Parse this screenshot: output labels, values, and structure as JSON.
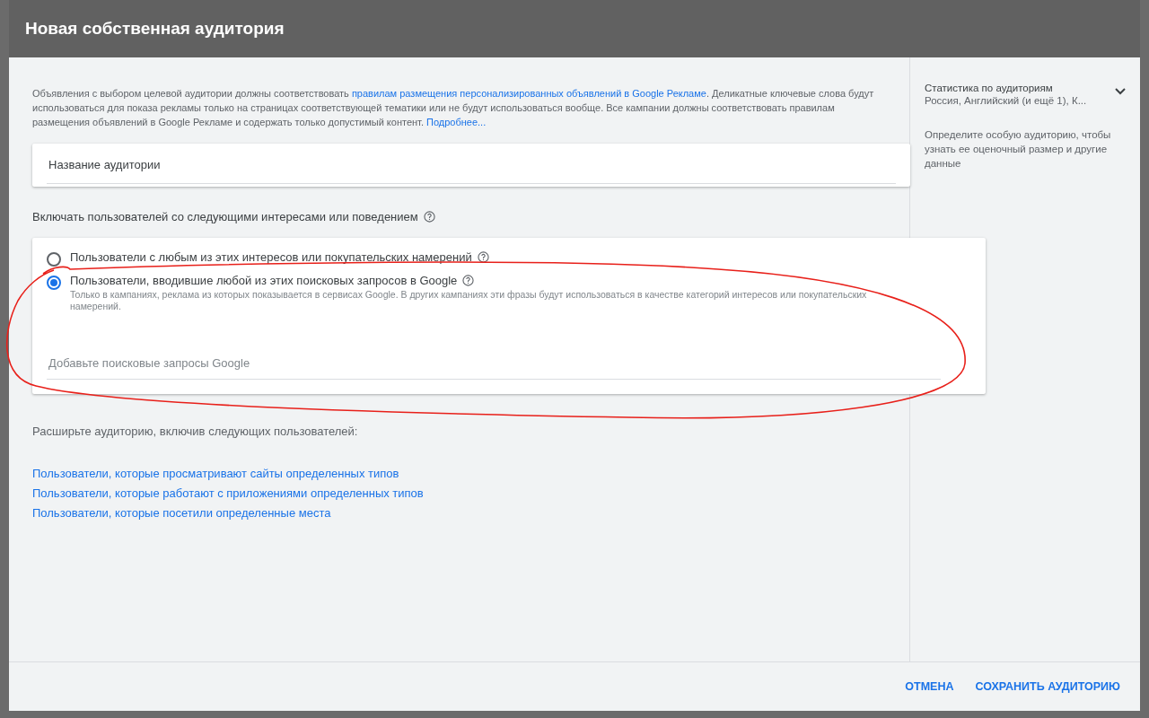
{
  "dialog": {
    "title": "Новая собственная аудитория"
  },
  "notice": {
    "text_before": "Объявления с выбором целевой аудитории должны соответствовать ",
    "link": "правилам размещения персонализированных объявлений в Google Рекламе",
    "text_after": ". Деликатные ключевые слова будут использоваться для показа рекламы только на страницах соответствующей тематики или не будут использоваться вообще. Все кампании должны соответствовать правилам размещения объявлений в Google Рекламе и содержать только допустимый контент. ",
    "more_link": "Подробнее..."
  },
  "name_field": {
    "placeholder": "Название аудитории"
  },
  "include_label": "Включать пользователей со следующими интересами или поведением",
  "options": [
    {
      "label": "Пользователи с любым из этих интересов или покупательских намерений",
      "selected": false
    },
    {
      "label": "Пользователи, вводившие любой из этих поисковых запросов в Google",
      "selected": true,
      "description": "Только в кампаниях, реклама из которых показывается в сервисах Google. В других кампаниях эти фразы будут использоваться в качестве категорий интересов или покупательских намерений."
    }
  ],
  "queries_field": {
    "placeholder": "Добавьте поисковые запросы Google"
  },
  "expand_label": "Расширьте аудиторию, включив следующих пользователей:",
  "expand_links": [
    "Пользователи, которые просматривают сайты определенных типов",
    "Пользователи, которые работают с приложениями определенных типов",
    "Пользователи, которые посетили определенные места"
  ],
  "side_panel": {
    "title": "Статистика по аудиториям",
    "subtitle": "Россия, Английский (и ещё 1), К...",
    "hint": "Определите особую аудиторию, чтобы узнать ее оценочный размер и другие данные"
  },
  "buttons": [
    "ОТМЕНА",
    "СОХРАНИТЬ АУДИТОРИЮ"
  ]
}
